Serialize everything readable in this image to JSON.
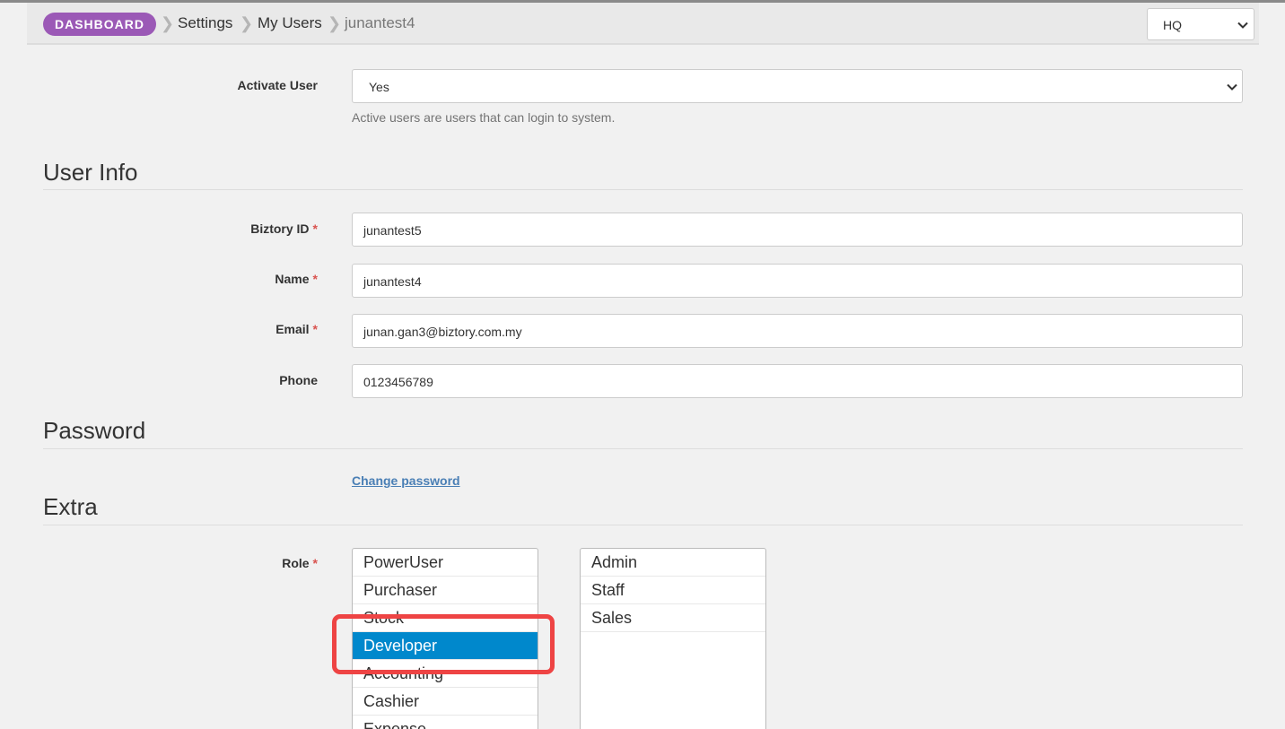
{
  "breadcrumb": {
    "badge": "DASHBOARD",
    "items": [
      "Settings",
      "My Users",
      "junantest4"
    ]
  },
  "branch_select": {
    "value": "HQ"
  },
  "activate": {
    "label": "Activate User",
    "value": "Yes",
    "help": "Active users are users that can login to system."
  },
  "sections": {
    "user_info": "User Info",
    "password": "Password",
    "extra": "Extra"
  },
  "user_info": {
    "biztory_id": {
      "label": "Biztory ID",
      "required": "*",
      "value": "junantest5"
    },
    "name": {
      "label": "Name",
      "required": "*",
      "value": "junantest4"
    },
    "email": {
      "label": "Email",
      "required": "*",
      "value": "junan.gan3@biztory.com.my"
    },
    "phone": {
      "label": "Phone",
      "value": "0123456789"
    }
  },
  "password": {
    "change_link": "Change password"
  },
  "role": {
    "label": "Role",
    "required": "*",
    "available": [
      "PowerUser",
      "Purchaser",
      "Stock",
      "Developer",
      "Accounting",
      "Cashier",
      "Expense"
    ],
    "selected_available": "Developer",
    "assigned": [
      "Admin",
      "Staff",
      "Sales"
    ]
  },
  "colors": {
    "badge": "#9b59b6",
    "selection": "#0088cc",
    "highlight": "#ee4444",
    "link": "#4a7fb5",
    "required": "#d9534f"
  }
}
